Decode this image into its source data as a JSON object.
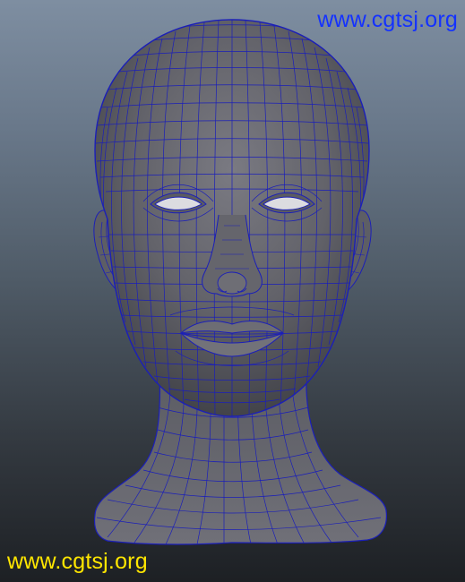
{
  "viewport": {
    "name": "3d-viewport",
    "background_top": "#7e8ea1",
    "background_bottom": "#1d2024"
  },
  "model": {
    "subject": "head-mesh",
    "wire_color": "#1b1fb8",
    "surface_color": "#67676e"
  },
  "watermarks": {
    "top_right": "www.cgtsj.org",
    "top_right_color": "#1432ff",
    "bottom_left": "www.cgtsj.org",
    "bottom_left_color": "#ffe600"
  }
}
